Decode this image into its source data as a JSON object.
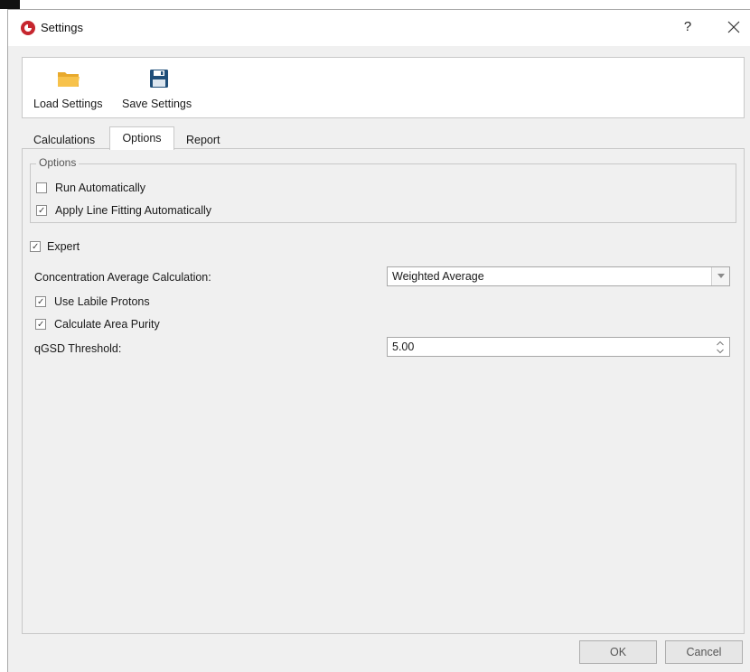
{
  "window": {
    "title": "Settings",
    "help_glyph": "?",
    "app_icon": "app-logo-icon",
    "accent": "#c6262e"
  },
  "toolbar": {
    "load_label": "Load Settings",
    "load_icon": "folder-icon",
    "save_label": "Save Settings",
    "save_icon": "floppy-disk-icon"
  },
  "tabs": [
    {
      "label": "Calculations",
      "active": false
    },
    {
      "label": "Options",
      "active": true
    },
    {
      "label": "Report",
      "active": false
    }
  ],
  "options_group": {
    "title": "Options",
    "run_automatically": {
      "label": "Run Automatically",
      "checked": false
    },
    "apply_line_fitting": {
      "label": "Apply Line Fitting Automatically",
      "checked": true
    }
  },
  "expert": {
    "label": "Expert",
    "checked": true
  },
  "concentration": {
    "label": "Concentration Average Calculation:",
    "value": "Weighted Average"
  },
  "use_labile_protons": {
    "label": "Use Labile Protons",
    "checked": true
  },
  "calculate_area_purity": {
    "label": "Calculate Area Purity",
    "checked": true
  },
  "qgsd": {
    "label": "qGSD Threshold:",
    "value": "5.00"
  },
  "buttons": {
    "ok": "OK",
    "cancel": "Cancel"
  }
}
